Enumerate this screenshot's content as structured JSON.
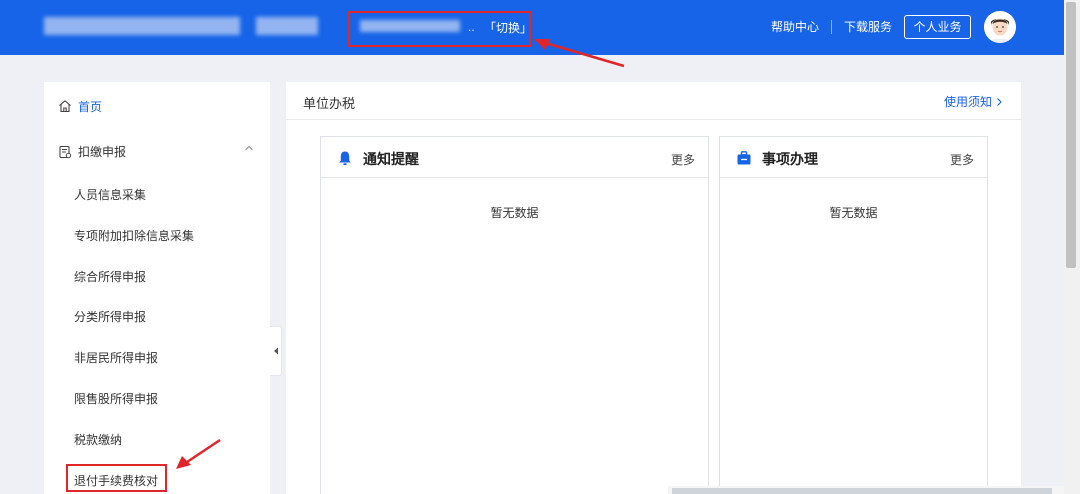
{
  "header": {
    "switch_label": "「切换」",
    "org_ellipsis": "..",
    "help_center": "帮助中心",
    "download_service": "下载服务",
    "personal_business": "个人业务"
  },
  "sidebar": {
    "home_label": "首页",
    "group_label": "扣缴申报",
    "items": [
      {
        "label": "人员信息采集"
      },
      {
        "label": "专项附加扣除信息采集"
      },
      {
        "label": "综合所得申报"
      },
      {
        "label": "分类所得申报"
      },
      {
        "label": "非居民所得申报"
      },
      {
        "label": "限售股所得申报"
      },
      {
        "label": "税款缴纳"
      },
      {
        "label": "退付手续费核对"
      }
    ]
  },
  "main": {
    "title": "单位办税",
    "notice_link": "使用须知",
    "cards": [
      {
        "title": "通知提醒",
        "more": "更多",
        "empty": "暂无数据",
        "icon": "bell-icon"
      },
      {
        "title": "事项办理",
        "more": "更多",
        "empty": "暂无数据",
        "icon": "briefcase-icon"
      }
    ]
  },
  "colors": {
    "brand_blue": "#1764e8",
    "highlight_red": "#e0262b"
  }
}
